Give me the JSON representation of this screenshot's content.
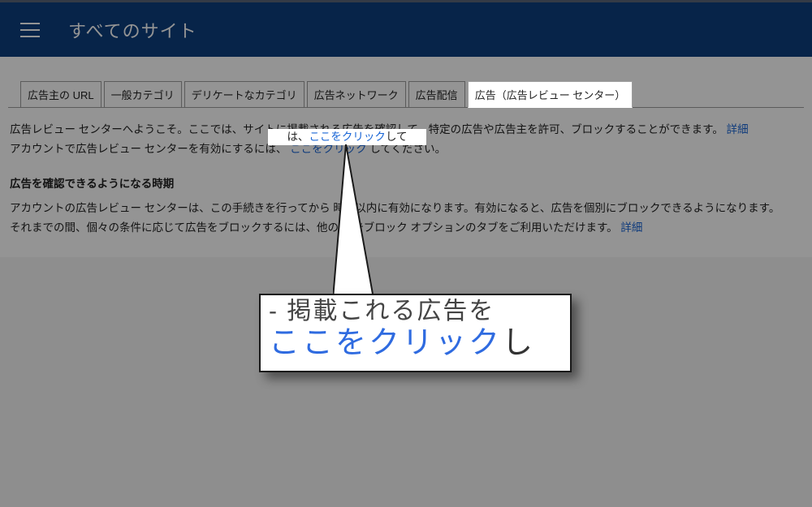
{
  "header": {
    "title": "すべてのサイト"
  },
  "tabs": [
    {
      "id": "advertiser-url",
      "label": "広告主の URL"
    },
    {
      "id": "general-category",
      "label": "一般カテゴリ"
    },
    {
      "id": "sensitive-category",
      "label": "デリケートなカテゴリ"
    },
    {
      "id": "ad-network",
      "label": "広告ネットワーク"
    },
    {
      "id": "ad-serving",
      "label": "広告配信"
    },
    {
      "id": "ad-review-center",
      "label": "広告（広告レビュー センター）"
    }
  ],
  "body": {
    "welcome_pre": "広告レビュー センターへようこそ。ここでは、サイトに掲載される広告を確認して、特定の広告や広告主を許可、ブロックすることができます。",
    "details1": "詳細",
    "line2_pre": "アカウントで広告レビュー センターを有効にするには、",
    "line2_link": "ここをクリック",
    "line2_post": "してください。",
    "subhead": "広告を確認できるようになる時期",
    "para2_a": "アカウントの広告レビュー センターは、この手続きを行ってから    時間以内に有効になります。有効になると、広告を個別にブロックできるようになります。",
    "para2_b": "それまでの間、個々の条件に応じて広告をブロックするには、他の  広告ブロック オプションのタブをご利用いただけます。",
    "details2": "詳細"
  },
  "spotlight": {
    "pre": "は、",
    "link": "ここをクリック",
    "post": "して"
  },
  "callout": {
    "top_partial": "- 掲載これる広告を",
    "big_link": "ここをクリック",
    "big_tail": "し"
  }
}
